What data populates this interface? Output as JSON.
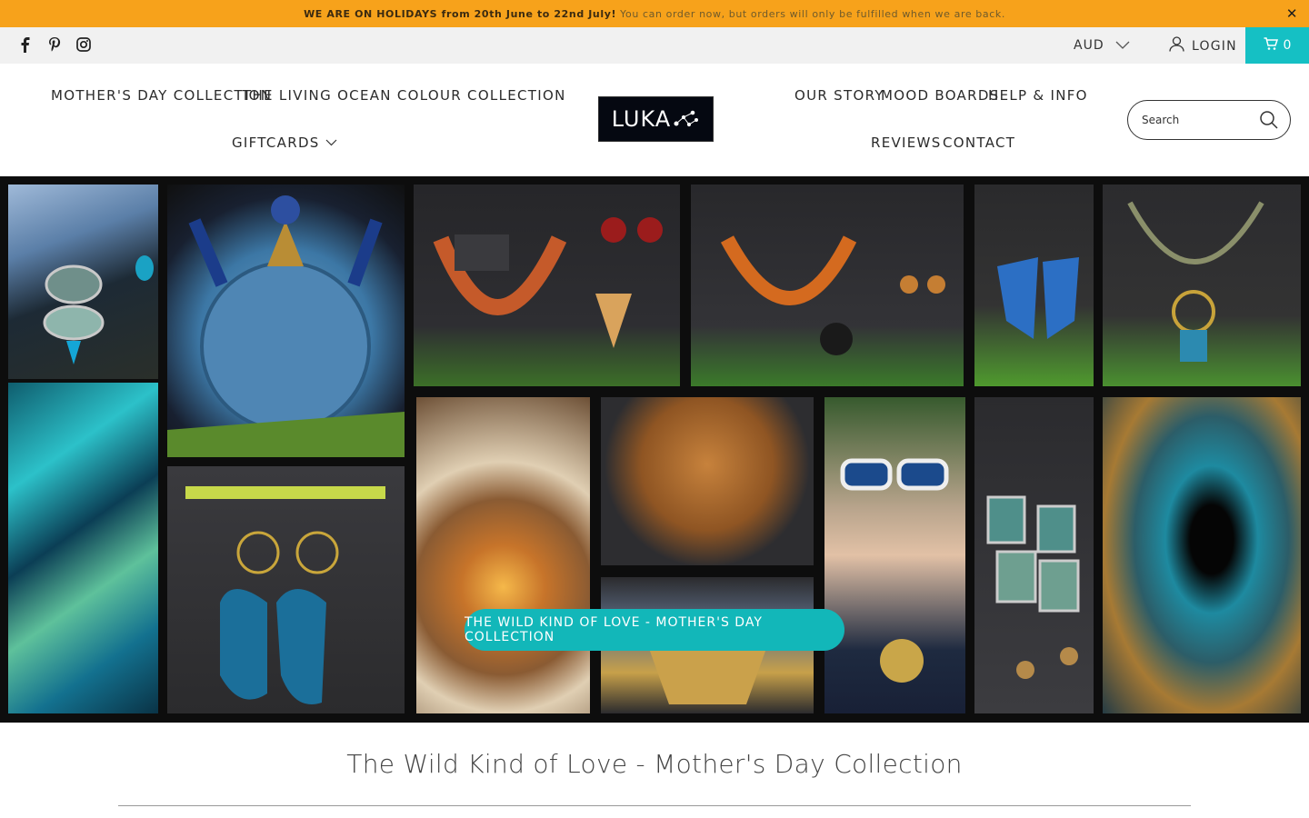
{
  "announcement": {
    "strong": "WE ARE ON HOLIDAYS from 20th June to 22nd July!",
    "soft": "You can order now, but orders will only be fulfilled when we are back."
  },
  "topbar": {
    "social_icons": [
      "facebook-icon",
      "pinterest-icon",
      "instagram-icon"
    ],
    "currency": "AUD",
    "login_label": "LOGIN",
    "cart_count": "0"
  },
  "nav": {
    "mothers_day": "MOTHER'S DAY COLLECTION",
    "living_ocean": "THE LIVING OCEAN COLOUR COLLECTION",
    "giftcards": "GIFTCARDS",
    "our_story": "OUR STORY",
    "mood_boards": "MOOD BOARDS",
    "help_info": "HELP & INFO",
    "reviews": "REVIEWS",
    "contact": "CONTACT"
  },
  "logo": {
    "text": "LUKA"
  },
  "search": {
    "placeholder": "Search"
  },
  "hero": {
    "button_label": "THE WILD KIND OF LOVE - MOTHER'S DAY COLLECTION"
  },
  "main": {
    "title": "The Wild Kind of Love - Mother's Day Collection"
  },
  "colors": {
    "announcement": "#f7a21b",
    "accent": "#15c0c4",
    "topbar": "#f1f1f1"
  }
}
